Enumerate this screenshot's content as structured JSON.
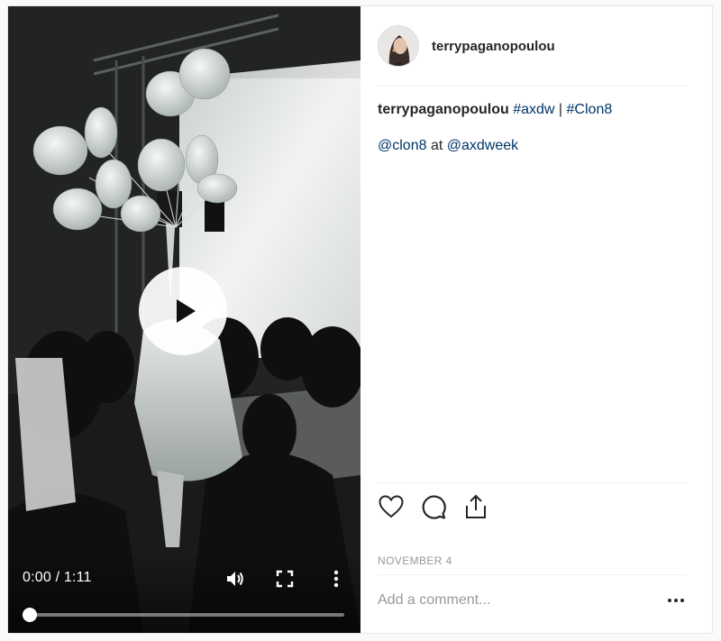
{
  "post": {
    "username": "terrypaganopoulou",
    "caption": {
      "user": "terrypaganopoulou",
      "tag1": "#axdw",
      "separator": " | ",
      "tag2": "#Clon8",
      "mention1": "@clon8",
      "at_text": " at ",
      "mention2": "@axdweek"
    },
    "date": "NOVEMBER 4",
    "comment_placeholder": "Add a comment..."
  },
  "video": {
    "time_display": "0:00 / 1:11",
    "progress_fraction": 0.0
  },
  "icons": {
    "play": "play-icon",
    "volume": "volume-icon",
    "fullscreen": "fullscreen-icon",
    "more_vertical": "more-vertical-icon",
    "like": "heart-icon",
    "comment": "comment-icon",
    "share": "share-icon",
    "more_horizontal": "more-horizontal-icon"
  },
  "colors": {
    "link": "#003569",
    "muted": "#999999",
    "text": "#262626",
    "border": "#efefef"
  }
}
